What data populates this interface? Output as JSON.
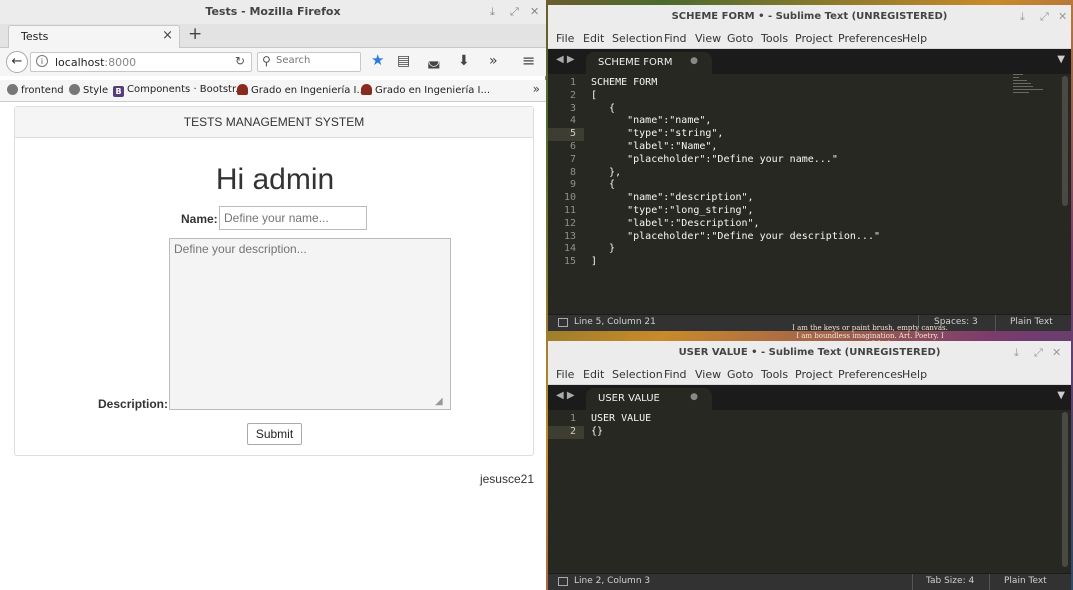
{
  "firefox": {
    "window_title": "Tests - Mozilla Firefox",
    "tab_title": "Tests",
    "url_host": "localhost",
    "url_port": ":8000",
    "search_placeholder": "Search",
    "bookmarks": [
      {
        "label": "frontend",
        "icon": "globe-icon",
        "color": "#666666"
      },
      {
        "label": "Style",
        "icon": "globe-icon",
        "color": "#666666"
      },
      {
        "label": "Components · Bootstr...",
        "icon": "bootstrap-icon",
        "color": "#563d7c"
      },
      {
        "label": "Grado en Ingeniería I...",
        "icon": "university-crest-icon",
        "color": "#8a2a1e"
      },
      {
        "label": "Grado en Ingeniería I...",
        "icon": "university-crest-icon",
        "color": "#8a2a1e"
      }
    ],
    "page": {
      "header": "TESTS MANAGEMENT SYSTEM",
      "greeting": "Hi admin",
      "name_label": "Name:",
      "name_placeholder": "Define your name...",
      "description_label": "Description:",
      "description_placeholder": "Define your description...",
      "submit_label": "Submit",
      "footer_user": "jesusce21"
    }
  },
  "sublime_scheme": {
    "window_title": "SCHEME FORM • - Sublime Text (UNREGISTERED)",
    "menu": [
      "File",
      "Edit",
      "Selection",
      "Find",
      "View",
      "Goto",
      "Tools",
      "Project",
      "Preferences",
      "Help"
    ],
    "tab_label": "SCHEME FORM",
    "current_line": 5,
    "lines": [
      "SCHEME FORM",
      "[",
      "   {",
      "      \"name\":\"name\",",
      "      \"type\":\"string\",",
      "      \"label\":\"Name\",",
      "      \"placeholder\":\"Define your name...\"",
      "   },",
      "   {",
      "      \"name\":\"description\",",
      "      \"type\":\"long_string\",",
      "      \"label\":\"Description\",",
      "      \"placeholder\":\"Define your description...\"",
      "   }",
      "]"
    ],
    "status_position": "Line 5, Column 21",
    "status_indent": "Spaces: 3",
    "status_syntax": "Plain Text"
  },
  "sublime_user": {
    "window_title": "USER VALUE • - Sublime Text (UNREGISTERED)",
    "menu": [
      "File",
      "Edit",
      "Selection",
      "Find",
      "View",
      "Goto",
      "Tools",
      "Project",
      "Preferences",
      "Help"
    ],
    "tab_label": "USER VALUE",
    "current_line": 2,
    "lines": [
      "USER VALUE",
      "{}"
    ],
    "status_position": "Line 2, Column 3",
    "status_indent": "Tab Size: 4",
    "status_syntax": "Plain Text"
  },
  "desktop_wallpaper_text": [
    "I am the keys or paint brush, empty canvas.",
    "I am boundless imagination. Art. Poetry. I sense. I feel."
  ]
}
